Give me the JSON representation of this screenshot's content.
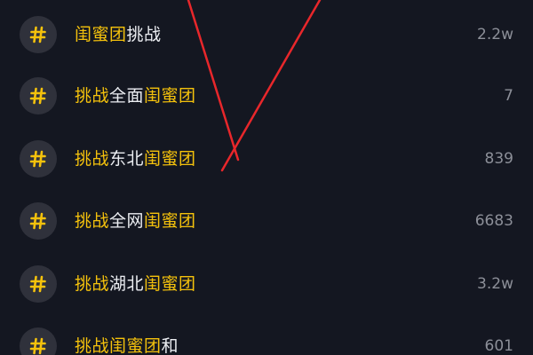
{
  "theme": {
    "background": "#141721",
    "highlight_color": "#f5c20c",
    "text_color": "#eceef2",
    "count_color": "#8c8f98",
    "icon_bg": "#2f313b",
    "annotation_color": "#e8272b"
  },
  "topic_list": {
    "icon": "hashtag-icon",
    "items": [
      {
        "segments": [
          {
            "text": "闺蜜团",
            "hl": true
          },
          {
            "text": "挑战",
            "hl": false
          }
        ],
        "count": "2.2w"
      },
      {
        "segments": [
          {
            "text": "挑战",
            "hl": true
          },
          {
            "text": "全面",
            "hl": false
          },
          {
            "text": "闺蜜团",
            "hl": true
          }
        ],
        "count": "7"
      },
      {
        "segments": [
          {
            "text": "挑战",
            "hl": true
          },
          {
            "text": "东北",
            "hl": false
          },
          {
            "text": "闺蜜团",
            "hl": true
          }
        ],
        "count": "839"
      },
      {
        "segments": [
          {
            "text": "挑战",
            "hl": true
          },
          {
            "text": "全网",
            "hl": false
          },
          {
            "text": "闺蜜团",
            "hl": true
          }
        ],
        "count": "6683"
      },
      {
        "segments": [
          {
            "text": "挑战",
            "hl": true
          },
          {
            "text": "湖北",
            "hl": false
          },
          {
            "text": "闺蜜团",
            "hl": true
          }
        ],
        "count": "3.2w"
      },
      {
        "segments": [
          {
            "text": "挑战闺蜜团",
            "hl": true
          },
          {
            "text": "和",
            "hl": false
          }
        ],
        "count": "601"
      }
    ]
  },
  "annotation": {
    "shape": "checkmark",
    "color": "#e8272b"
  }
}
